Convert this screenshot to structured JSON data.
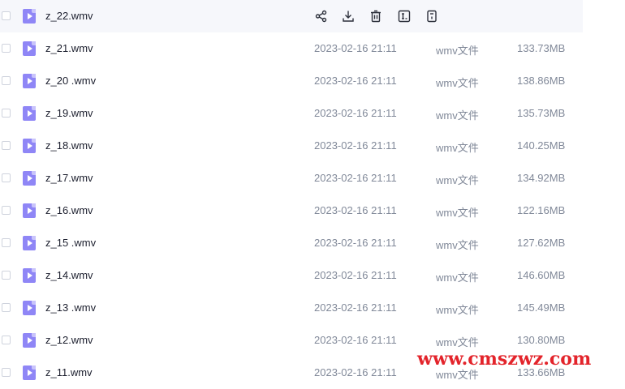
{
  "files": [
    {
      "name": "z_22.wmv",
      "date": "",
      "type": "",
      "size": "",
      "hovered": true
    },
    {
      "name": "z_21.wmv",
      "date": "2023-02-16 21:11",
      "type": "wmv文件",
      "size": "133.73MB"
    },
    {
      "name": "z_20 .wmv",
      "date": "2023-02-16 21:11",
      "type": "wmv文件",
      "size": "138.86MB"
    },
    {
      "name": "z_19.wmv",
      "date": "2023-02-16 21:11",
      "type": "wmv文件",
      "size": "135.73MB"
    },
    {
      "name": "z_18.wmv",
      "date": "2023-02-16 21:11",
      "type": "wmv文件",
      "size": "140.25MB"
    },
    {
      "name": "z_17.wmv",
      "date": "2023-02-16 21:11",
      "type": "wmv文件",
      "size": "134.92MB"
    },
    {
      "name": "z_16.wmv",
      "date": "2023-02-16 21:11",
      "type": "wmv文件",
      "size": "122.16MB"
    },
    {
      "name": "z_15 .wmv",
      "date": "2023-02-16 21:11",
      "type": "wmv文件",
      "size": "127.62MB"
    },
    {
      "name": "z_14.wmv",
      "date": "2023-02-16 21:11",
      "type": "wmv文件",
      "size": "146.60MB"
    },
    {
      "name": "z_13 .wmv",
      "date": "2023-02-16 21:11",
      "type": "wmv文件",
      "size": "145.49MB"
    },
    {
      "name": "z_12.wmv",
      "date": "2023-02-16 21:11",
      "type": "wmv文件",
      "size": "130.80MB"
    },
    {
      "name": "z_11.wmv",
      "date": "2023-02-16 21:11",
      "type": "wmv文件",
      "size": "133.66MB"
    }
  ],
  "hover_actions": [
    "share-icon",
    "download-icon",
    "delete-icon",
    "rename-icon",
    "more-icon"
  ],
  "colors": {
    "file_icon": "#8f86f6",
    "hover_row": "#f6f7fb",
    "meta_text": "#818999",
    "watermark": "#e3242b"
  },
  "watermark": {
    "text": "www.cmszwz.com"
  }
}
